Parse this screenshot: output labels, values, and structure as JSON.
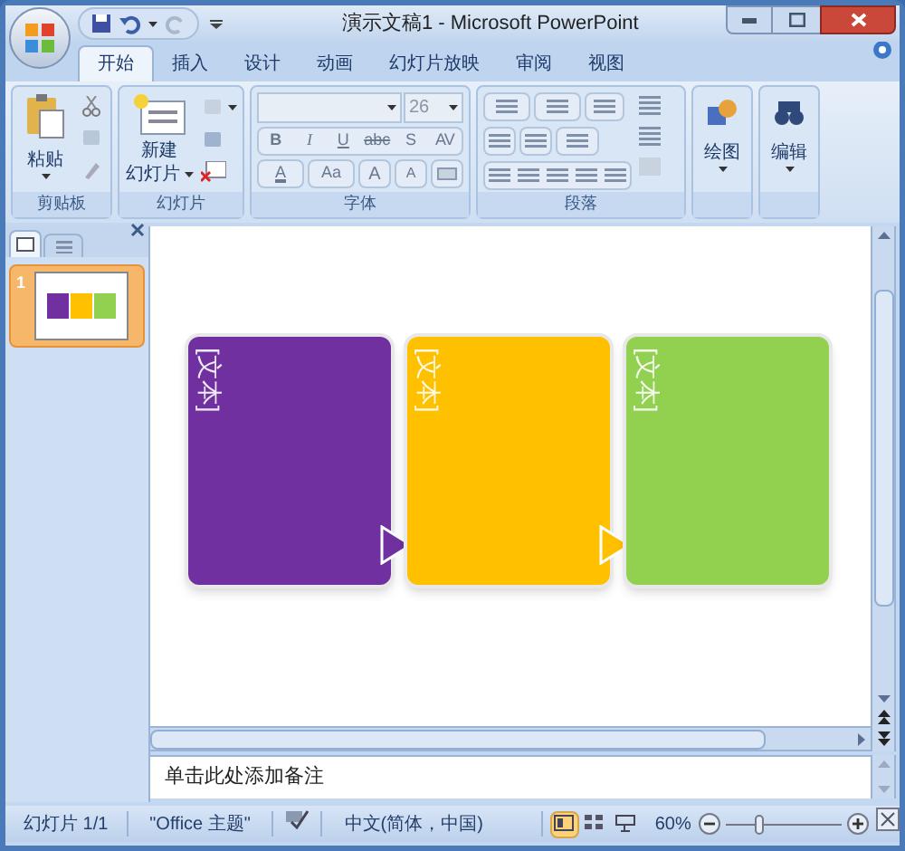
{
  "window": {
    "title": "演示文稿1 - Microsoft PowerPoint"
  },
  "tabs": [
    {
      "label": "开始",
      "selected": true
    },
    {
      "label": "插入",
      "selected": false
    },
    {
      "label": "设计",
      "selected": false
    },
    {
      "label": "动画",
      "selected": false
    },
    {
      "label": "幻灯片放映",
      "selected": false
    },
    {
      "label": "审阅",
      "selected": false
    },
    {
      "label": "视图",
      "selected": false
    }
  ],
  "ribbon": {
    "clipboard": {
      "label": "剪贴板",
      "paste": "粘贴"
    },
    "slides": {
      "label": "幻灯片",
      "new_slide": [
        "新建",
        "幻灯片"
      ]
    },
    "font": {
      "label": "字体",
      "font_size": "26",
      "format_buttons": [
        "B",
        "I",
        "U",
        "abc",
        "S",
        "AV"
      ],
      "color_button": "A",
      "case_button": "Aa",
      "grow_button": "A",
      "shrink_button": "A"
    },
    "paragraph": {
      "label": "段落"
    },
    "drawing": {
      "label": "绘图"
    },
    "editing": {
      "label": "编辑"
    }
  },
  "slide_panel": {
    "thumbnails": [
      {
        "number": "1",
        "selected": true
      }
    ]
  },
  "slide": {
    "shapes": [
      {
        "text": "[文本]",
        "color": "#7030a0",
        "arrow": true
      },
      {
        "text": "[文本]",
        "color": "#ffc000",
        "arrow": true
      },
      {
        "text": "[文本]",
        "color": "#92d050",
        "arrow": false
      }
    ]
  },
  "notes": {
    "placeholder": "单击此处添加备注"
  },
  "status_bar": {
    "slide": "幻灯片 1/1",
    "theme": "\"Office 主题\"",
    "language": "中文(简体，中国)",
    "views": [
      {
        "kind": "normal",
        "selected": true
      },
      {
        "kind": "sorter",
        "selected": false
      },
      {
        "kind": "show",
        "selected": false
      }
    ],
    "zoom": "60%",
    "zoom_slider": {
      "level": 0.3
    }
  }
}
